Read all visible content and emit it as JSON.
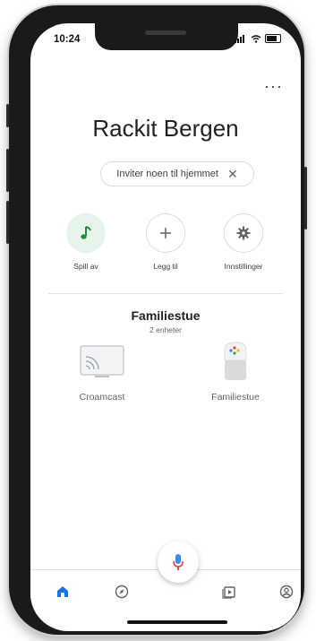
{
  "status_bar": {
    "time": "10:24"
  },
  "header": {
    "more_menu": "···",
    "home_name": "Rackit Bergen"
  },
  "invite_chip": {
    "label": "Inviter noen til hjemmet",
    "close_symbol": "✕"
  },
  "actions": [
    {
      "label": "Spill av",
      "icon": "music-note-icon"
    },
    {
      "label": "Legg til",
      "icon": "plus-icon"
    },
    {
      "label": "Innstillinger",
      "icon": "gear-icon"
    }
  ],
  "room": {
    "name": "Familiestue",
    "count": "2 enheter",
    "devices": [
      {
        "label": "Croamcast",
        "icon": "chromecast-tv-icon"
      },
      {
        "label": "Familiestue",
        "icon": "google-home-speaker-icon"
      }
    ]
  },
  "bottom_nav": [
    {
      "name": "home",
      "icon": "home-icon",
      "active": true
    },
    {
      "name": "discover",
      "icon": "compass-icon"
    },
    {
      "name": "media",
      "icon": "media-icon"
    },
    {
      "name": "account",
      "icon": "account-icon"
    }
  ],
  "colors": {
    "accent_blue": "#1a73e8",
    "accent_green": "#1e8e3e",
    "mic_red": "#ea4335"
  }
}
